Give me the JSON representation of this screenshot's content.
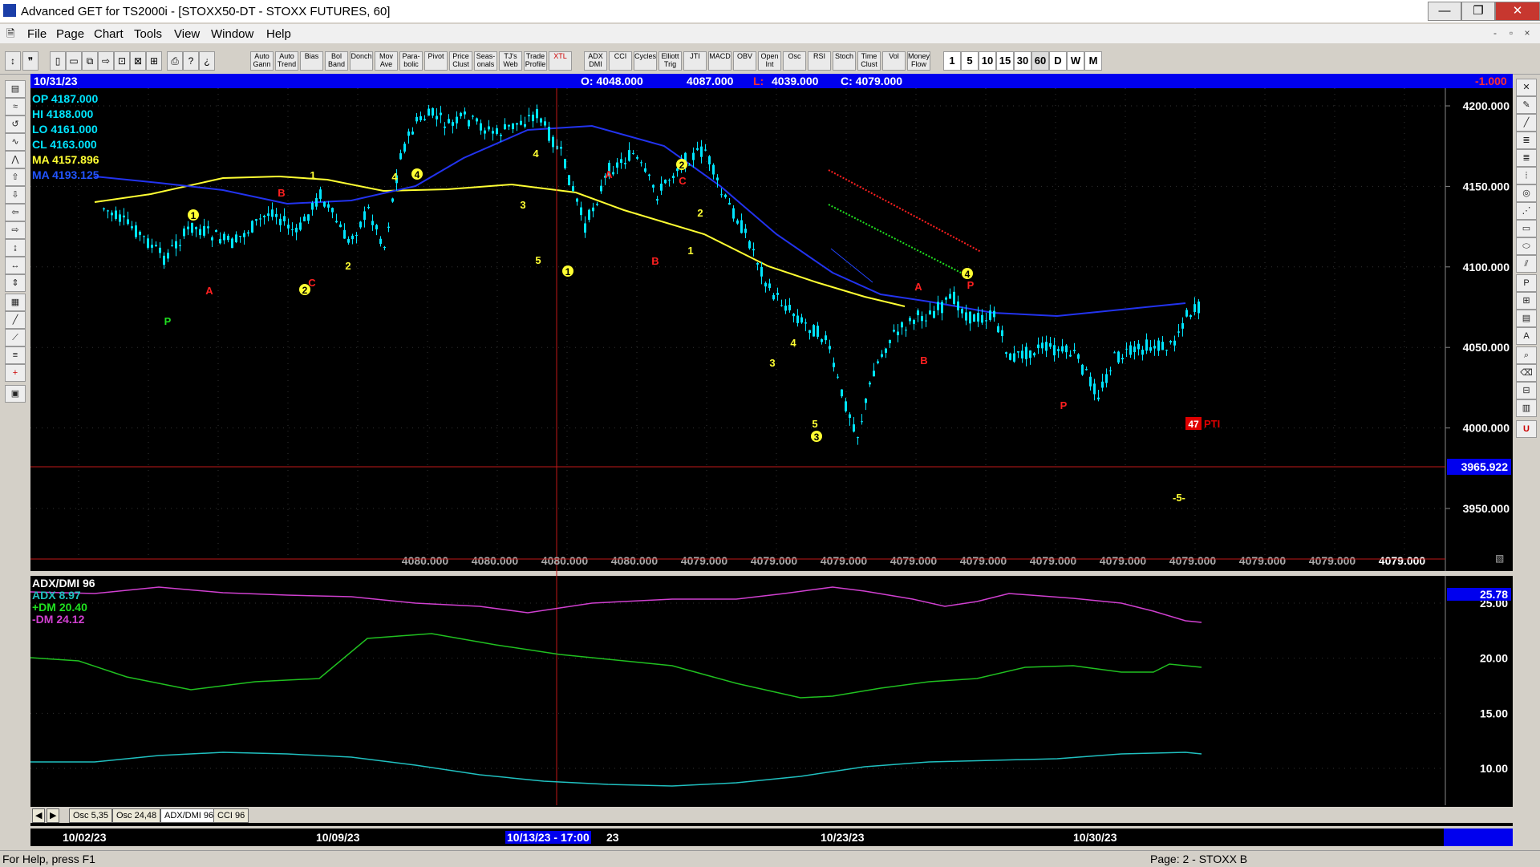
{
  "window": {
    "title": "Advanced GET for TS2000i - [STOXX50-DT - STOXX FUTURES, 60]",
    "min_symbol": "—",
    "max_symbol": "❐",
    "close_symbol": "✕"
  },
  "menu": [
    "File",
    "Page",
    "Chart",
    "Tools",
    "View",
    "Window",
    "Help"
  ],
  "mdi_buttons": [
    "-",
    "▫",
    "×"
  ],
  "toolbar": {
    "studies": [
      "Auto Gann",
      "Auto Trend",
      "Bias",
      "Bol Band",
      "Donch",
      "Mov Ave",
      "Para-bolic",
      "Pivot",
      "Price Clust",
      "Seas-onals",
      "TJ's Web",
      "Trade Profile",
      "XTL",
      "ADX DMI",
      "CCI",
      "Cycles",
      "Elliott Trig",
      "JTI",
      "MACD",
      "OBV",
      "Open Int",
      "Osc",
      "RSI",
      "Stoch",
      "Time Clust",
      "Vol",
      "Money Flow"
    ],
    "intervals": [
      "1",
      "5",
      "10",
      "15",
      "30",
      "60",
      "D",
      "W",
      "M"
    ]
  },
  "chart": {
    "header": {
      "date": "10/31/23",
      "open": "O: 4048.000",
      "high": "4087.000",
      "low_label": "L:",
      "low": "4039.000",
      "close": "C: 4079.000",
      "change": "-1.000"
    },
    "legend": [
      {
        "text": "OP 4187.000",
        "color": "#00e5ff"
      },
      {
        "text": "HI  4188.000",
        "color": "#00e5ff"
      },
      {
        "text": "LO  4161.000",
        "color": "#00e5ff"
      },
      {
        "text": "CL  4163.000",
        "color": "#00e5ff"
      },
      {
        "text": "MA  4157.896",
        "color": "#ffff33"
      },
      {
        "text": "MA  4193.125",
        "color": "#2255ff"
      }
    ],
    "price_axis": [
      "4200.000",
      "4150.000",
      "4100.000",
      "4050.000",
      "4000.000",
      "3950.000"
    ],
    "cursor_price": "3965.922",
    "bottom_values": [
      "4080.000",
      "4080.000",
      "4080.000",
      "4080.000",
      "4079.000",
      "4079.000",
      "4079.000",
      "4079.000",
      "4079.000",
      "4079.000",
      "4079.000",
      "4079.000",
      "4079.000",
      "4079.000",
      "4079.000"
    ],
    "pti_value": "47",
    "pti_label": "PTI",
    "projection_label": "-5-",
    "wave_labels": [
      {
        "text": "1",
        "kind": "circle"
      },
      {
        "text": "2",
        "kind": "circle"
      },
      {
        "text": "2",
        "kind": "circle"
      },
      {
        "text": "1",
        "kind": "circle"
      },
      {
        "text": "4",
        "kind": "circle"
      },
      {
        "text": "4",
        "kind": "circle"
      },
      {
        "text": "3",
        "kind": "circle"
      },
      {
        "text": "1",
        "kind": "plain"
      },
      {
        "text": "4",
        "kind": "plain"
      },
      {
        "text": "2",
        "kind": "plain"
      },
      {
        "text": "4",
        "kind": "plain"
      },
      {
        "text": "3",
        "kind": "plain"
      },
      {
        "text": "5",
        "kind": "plain"
      },
      {
        "text": "2",
        "kind": "plain"
      },
      {
        "text": "1",
        "kind": "plain"
      },
      {
        "text": "4",
        "kind": "plain"
      },
      {
        "text": "3",
        "kind": "plain"
      },
      {
        "text": "5",
        "kind": "plain"
      },
      {
        "text": "P",
        "kind": "green"
      },
      {
        "text": "A",
        "kind": "red"
      },
      {
        "text": "B",
        "kind": "red"
      },
      {
        "text": "C",
        "kind": "red"
      },
      {
        "text": "A",
        "kind": "red"
      },
      {
        "text": "C",
        "kind": "red"
      },
      {
        "text": "B",
        "kind": "red"
      },
      {
        "text": "A",
        "kind": "red"
      },
      {
        "text": "B",
        "kind": "red"
      },
      {
        "text": "P",
        "kind": "red"
      },
      {
        "text": "P",
        "kind": "red"
      }
    ]
  },
  "indicator": {
    "title": "ADX/DMI 96",
    "adx": "ADX 8.97",
    "dm_plus": "+DM 20.40",
    "dm_minus": "-DM  24.12",
    "axis": [
      "25.00",
      "20.00",
      "15.00",
      "10.00"
    ],
    "cursor_value": "25.78",
    "adx_color": "#20c0c0",
    "dm_plus_color": "#20c020",
    "dm_minus_color": "#d040d0"
  },
  "tabs": [
    "Osc 5,35",
    "Osc 24,48",
    "ADX/DMI 96",
    "CCI 96"
  ],
  "time_axis": [
    "10/02/23",
    "10/09/23",
    "10/13/23 - 17:00",
    "23",
    "10/23/23",
    "10/30/23"
  ],
  "status": {
    "help": "For Help, press F1",
    "page": "Page: 2 - STOXX B"
  }
}
